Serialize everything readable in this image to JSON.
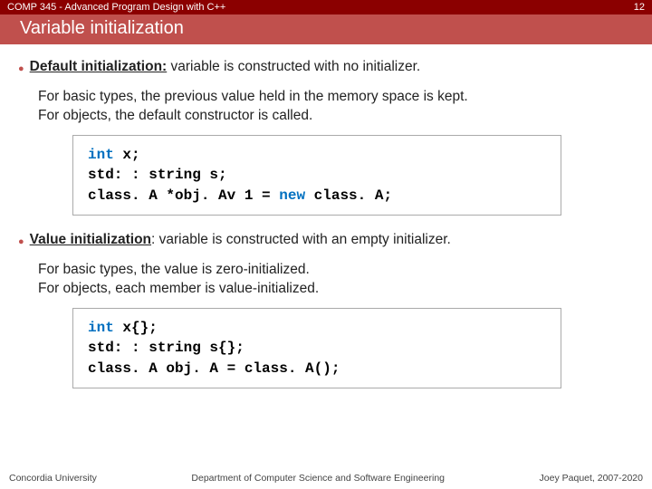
{
  "header": {
    "course": "COMP 345 - Advanced Program Design with C++",
    "page": "12"
  },
  "title": "Variable initialization",
  "items": [
    {
      "term": "Default initialization:",
      "rest": " variable is constructed with no initializer.",
      "sub1": "For basic types, the previous value held in the memory space is kept.",
      "sub2": "For objects, the default constructor is called.",
      "code": {
        "l1a": "int",
        "l1b": " x;",
        "l2a": "std: : string s;",
        "l3a": "class. A *obj. Av 1 = ",
        "l3b": "new",
        "l3c": " class. A;"
      }
    },
    {
      "term": "Value initialization",
      "rest": ": variable is constructed with an empty initializer.",
      "sub1": "For basic types, the value is zero-initialized.",
      "sub2": "For objects, each member is value-initialized.",
      "code": {
        "l1a": "int",
        "l1b": " x{};",
        "l2a": "std: : string s{};",
        "l3a": "class. A obj. A = class. A();",
        "l3b": "",
        "l3c": ""
      }
    }
  ],
  "footer": {
    "left": "Concordia University",
    "center": "Department of Computer Science and Software Engineering",
    "right": "Joey Paquet, 2007-2020"
  }
}
